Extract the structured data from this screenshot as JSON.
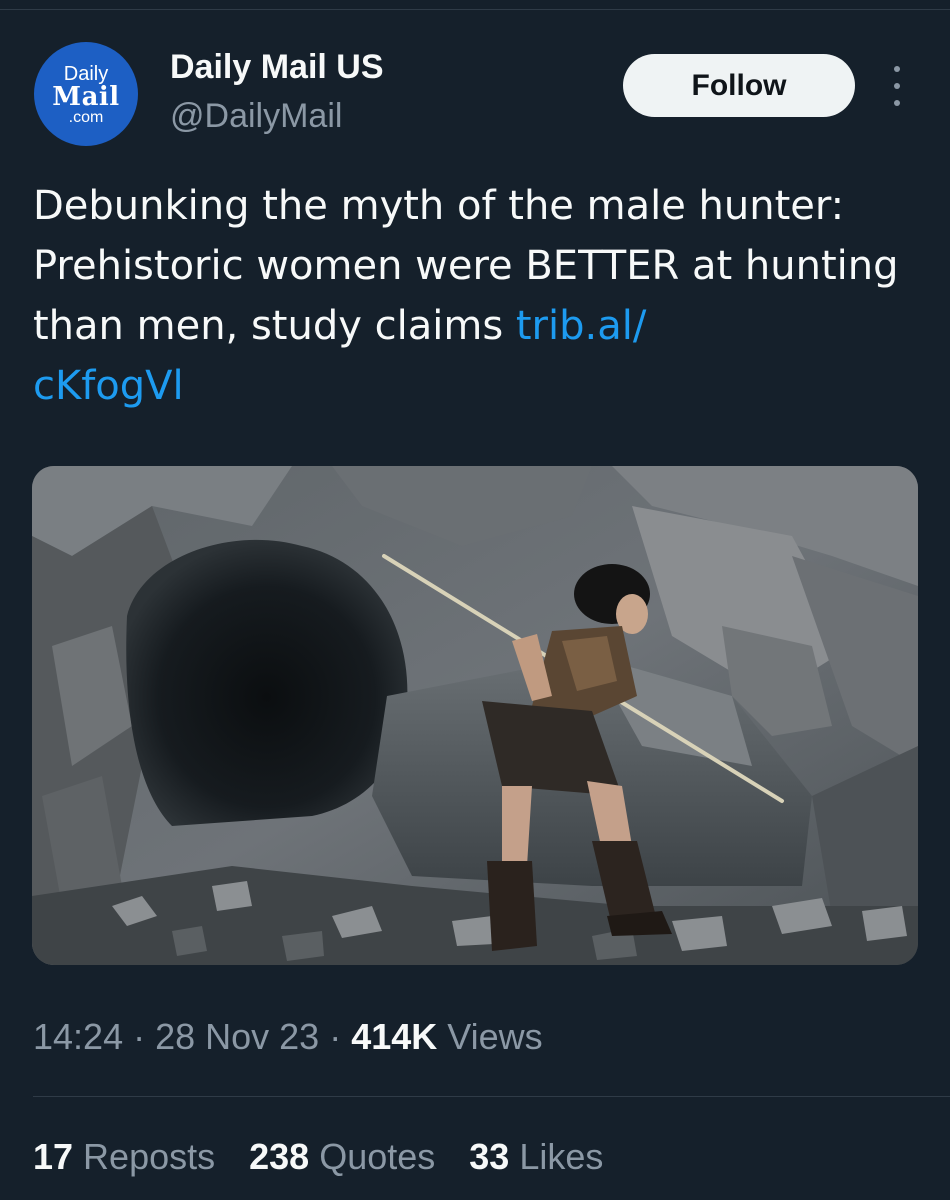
{
  "author": {
    "avatar": {
      "line1": "Daily",
      "line2": "Mail",
      "line3": ".com"
    },
    "display_name": "Daily Mail US",
    "handle": "@DailyMail"
  },
  "follow_label": "Follow",
  "more_icon": "more-vertical-icon",
  "tweet": {
    "text": "Debunking the myth of the male hunter: Prehistoric women were BETTER at hunting than men, study claims ",
    "link_line1": "trib.al/",
    "link_line2": "cKfogVl"
  },
  "meta": {
    "time": "14:24",
    "sep1": " · ",
    "date": "28 Nov 23",
    "sep2": " · ",
    "views_count": "414K",
    "views_label": " Views"
  },
  "stats": {
    "reposts_count": "17",
    "reposts_label": " Reposts",
    "quotes_count": "238",
    "quotes_label": " Quotes",
    "likes_count": "33",
    "likes_label": " Likes"
  },
  "colors": {
    "background": "#15202b",
    "link": "#1d9bf0",
    "muted": "#8b98a5",
    "avatar_blue": "#1d5fc4"
  }
}
